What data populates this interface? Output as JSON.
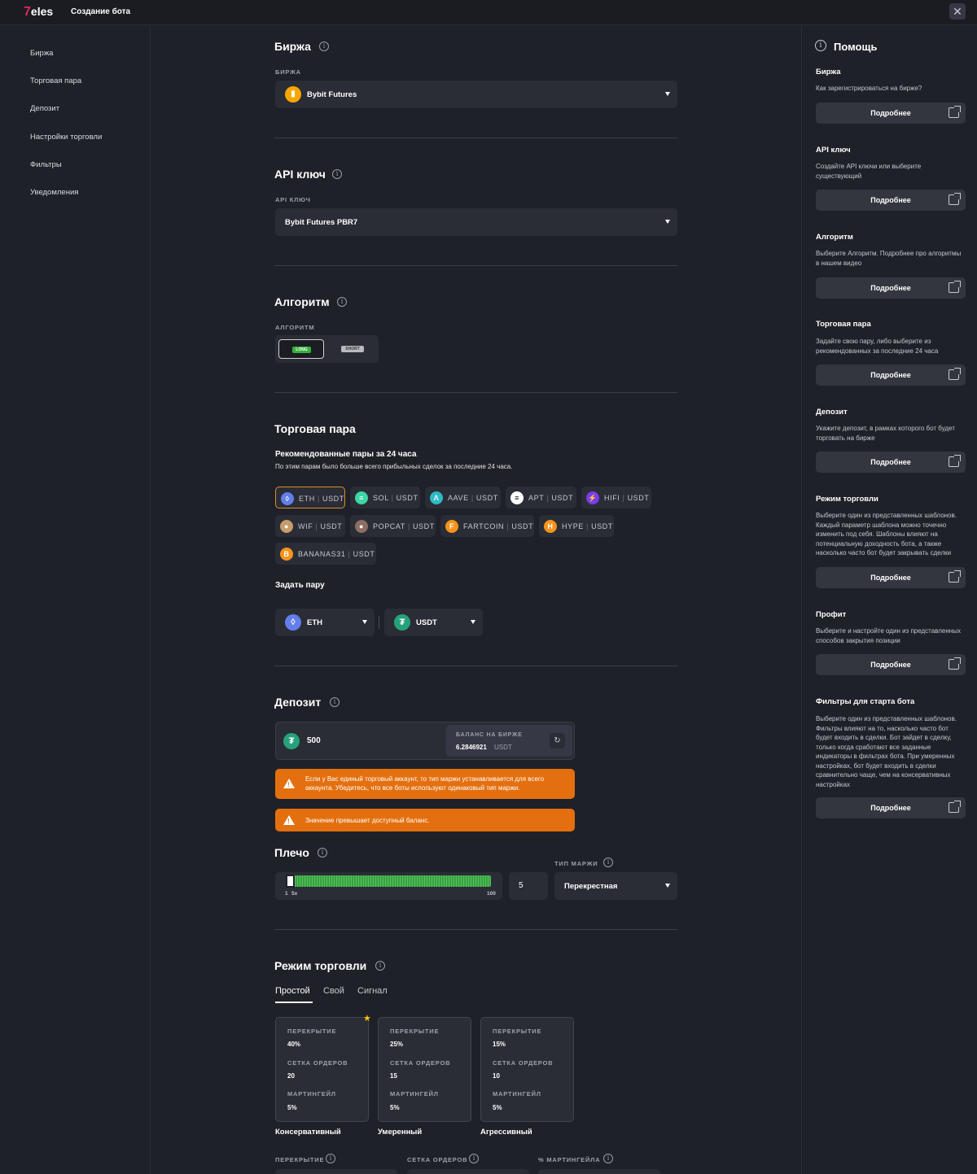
{
  "topbar": {
    "logo_mark": "7",
    "logo_text": "eles",
    "title": "Создание бота",
    "close": "✕"
  },
  "nav": [
    "Биржа",
    "Торговая пара",
    "Депозит",
    "Настройки торговли",
    "Фильтры",
    "Уведомления"
  ],
  "exchange": {
    "title": "Биржа",
    "label": "БИРЖА",
    "value": "Bybit Futures"
  },
  "api": {
    "title": "API ключ",
    "label": "API КЛЮЧ",
    "value": "Bybit Futures PBR7"
  },
  "algo": {
    "title": "Алгоритм",
    "label": "АЛГОРИТМ",
    "long": "LONG",
    "short": "SHORT"
  },
  "pair": {
    "title": "Торговая пара",
    "rec_title": "Рекомендованные пары за 24 часа",
    "rec_sub": "По этим парам было больше всего прибыльных сделок за последние 24 часа.",
    "chips": [
      {
        "base": "ETH",
        "quote": "USDT",
        "color": "#627eea",
        "glyph": "◊"
      },
      {
        "base": "SOL",
        "quote": "USDT",
        "color": "#3cd7a4",
        "glyph": "≡"
      },
      {
        "base": "AAVE",
        "quote": "USDT",
        "color": "#2ebac6",
        "glyph": "Λ"
      },
      {
        "base": "APT",
        "quote": "USDT",
        "color": "#ffffff",
        "glyph": "≡"
      },
      {
        "base": "HIFI",
        "quote": "USDT",
        "color": "#7a3cf0",
        "glyph": "⚡"
      },
      {
        "base": "WIF",
        "quote": "USDT",
        "color": "#c79b6b",
        "glyph": "●"
      },
      {
        "base": "POPCAT",
        "quote": "USDT",
        "color": "#8c6e62",
        "glyph": "●"
      },
      {
        "base": "FARTCOIN",
        "quote": "USDT",
        "color": "#f7931a",
        "glyph": "F"
      },
      {
        "base": "HYPE",
        "quote": "USDT",
        "color": "#f7931a",
        "glyph": "H"
      },
      {
        "base": "BANANAS31",
        "quote": "USDT",
        "color": "#f7931a",
        "glyph": "B"
      }
    ],
    "set_pair": "Задать пару",
    "base": "ETH",
    "quote": "USDT"
  },
  "deposit": {
    "title": "Депозит",
    "amount": "500",
    "balance_label": "БАЛАНС НА БИРЖЕ",
    "balance_value": "6.2846921",
    "balance_unit": "USDT",
    "warn1": "Если у Вас единый торговый аккаунт, то тип маржи устанавливается для всего аккаунта. Убедитесь, что все боты используют одинаковый тип маржи.",
    "warn2": "Значение превышает доступный баланс."
  },
  "leverage": {
    "title": "Плечо",
    "min": "1",
    "unit": "5x",
    "max": "100",
    "value": "5",
    "level": 1,
    "margin_label": "ТИП МАРЖИ",
    "margin_value": "Перекрестная"
  },
  "mode": {
    "title": "Режим торговли",
    "tabs": [
      "Простой",
      "Свой",
      "Сигнал"
    ],
    "cards": [
      {
        "name": "Консервативный",
        "overlap": "40%",
        "grid": "20",
        "martin": "5%"
      },
      {
        "name": "Умеренный",
        "overlap": "25%",
        "grid": "15",
        "martin": "5%"
      },
      {
        "name": "Агрессивный",
        "overlap": "15%",
        "grid": "10",
        "martin": "5%"
      }
    ],
    "k_overlap": "ПЕРЕКРЫТИЕ",
    "k_grid": "СЕТКА ОРДЕРОВ",
    "k_martin": "МАРТИНГЕЙЛ",
    "f_overlap": "ПЕРЕКРЫТИЕ",
    "f_grid": "СЕТКА ОРДЕРОВ",
    "f_martin": "% МАРТИНГЕЙЛА"
  },
  "help": {
    "title": "Помощь",
    "btn": "Подробнее",
    "items": [
      {
        "h": "Биржа",
        "t": "Как зарегистрироваться на бирже?"
      },
      {
        "h": "API ключ",
        "t": "Создайте API ключи или выберите существующий"
      },
      {
        "h": "Алгоритм",
        "t": "Выберите Алгоритм. Подробнее про алгоритмы в нашем видео"
      },
      {
        "h": "Торговая пара",
        "t": "Задайте свою пару, либо выберите из рекомендованных за последние 24 часа"
      },
      {
        "h": "Депозит",
        "t": "Укажите депозит, в рамках которого бот будет торговать на бирже"
      },
      {
        "h": "Режим торговли",
        "t": "Выберите один из представленных шаблонов. Каждый параметр шаблона можно точечно изменить под себя. Шаблоны влияют на потенциальную доходность бота, а также насколько часто бот будет закрывать сделки"
      },
      {
        "h": "Профит",
        "t": "Выберите и настройте один из представленных способов закрытия позиции"
      },
      {
        "h": "Фильтры для старта бота",
        "t": "Выберите один из представленных шаблонов. Фильтры влияют на то, насколько часто бот будет входить в сделки. Бот зайдет в сделку, только когда сработают все заданные индикаторы в фильтрах бота. При умеренных настройках, бот будет входить в сделки сравнительно чаще, чем на консервативных настройках"
      }
    ]
  }
}
